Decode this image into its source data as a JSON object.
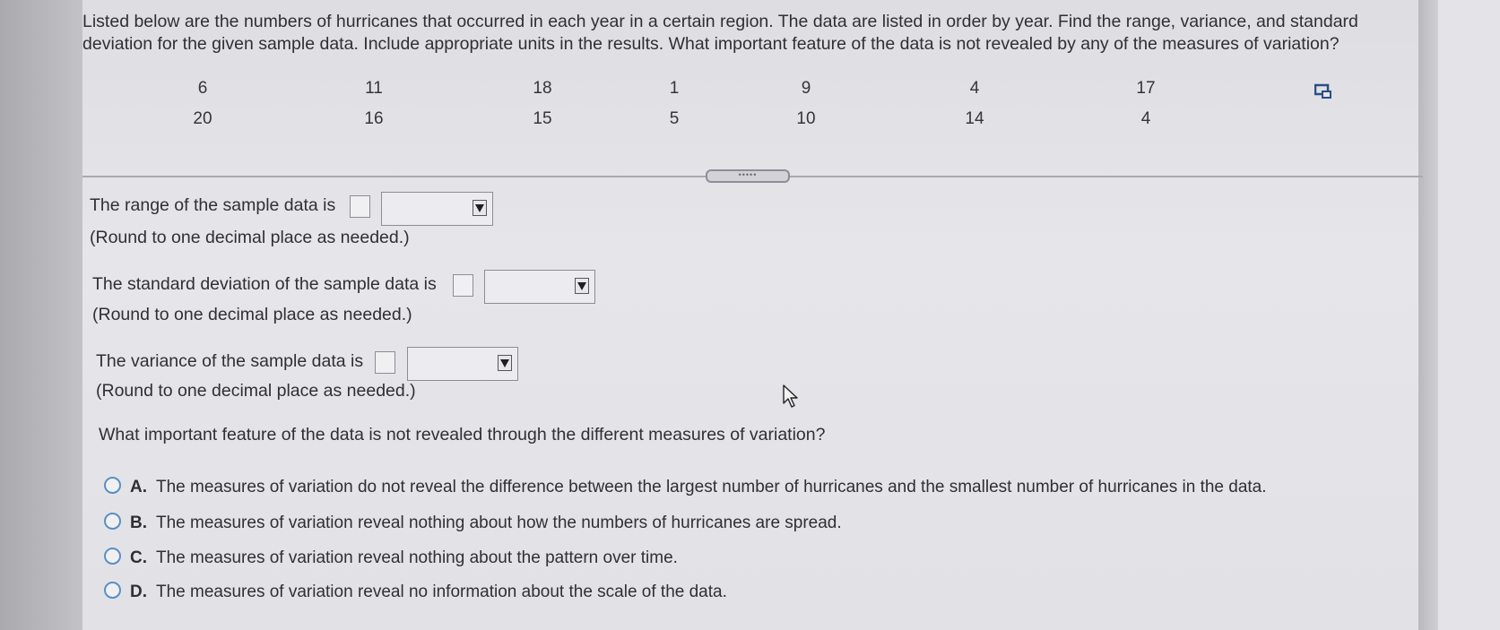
{
  "question": {
    "line1": "Listed below are the numbers of hurricanes that occurred in each year in a certain region. The data are listed in order by year. Find the range, variance, and standard",
    "line2": "deviation for the given sample data. Include appropriate units in the results. What important feature of the data is not revealed by any of the measures of variation?"
  },
  "data": {
    "row1": [
      "6",
      "11",
      "18",
      "1",
      "9",
      "4",
      "17"
    ],
    "row2": [
      "20",
      "16",
      "15",
      "5",
      "10",
      "14",
      "4"
    ]
  },
  "divider_handle": "•••••",
  "answers": {
    "range_label": "The range of the sample data is",
    "range_note": "(Round to one decimal place as needed.)",
    "sd_label": "The standard deviation of the sample data is",
    "sd_note": "(Round to one decimal place as needed.)",
    "variance_label": "The variance of the sample data is",
    "variance_note": "(Round to one decimal place as needed.)",
    "range_value": "",
    "sd_value": "",
    "variance_value": "",
    "range_unit": "",
    "sd_unit": "",
    "variance_unit": ""
  },
  "feature_question": "What important feature of the data is not revealed through the different measures of variation?",
  "choices": [
    {
      "letter": "A.",
      "text": "The measures of variation do not reveal the difference between the largest number of hurricanes and the smallest number of hurricanes in the data."
    },
    {
      "letter": "B.",
      "text": "The measures of variation reveal nothing about how the numbers of hurricanes are spread."
    },
    {
      "letter": "C.",
      "text": "The measures of variation reveal nothing about the pattern over time."
    },
    {
      "letter": "D.",
      "text": "The measures of variation reveal no information about the scale of the data."
    }
  ],
  "icons": {
    "copy": "copy-icon",
    "dropdown": "dropdown-arrow-icon",
    "cursor": "mouse-pointer-icon"
  },
  "colors": {
    "radio_border": "#5a8fc5",
    "panel": "#e4e4e8",
    "text": "#2f2f34"
  }
}
